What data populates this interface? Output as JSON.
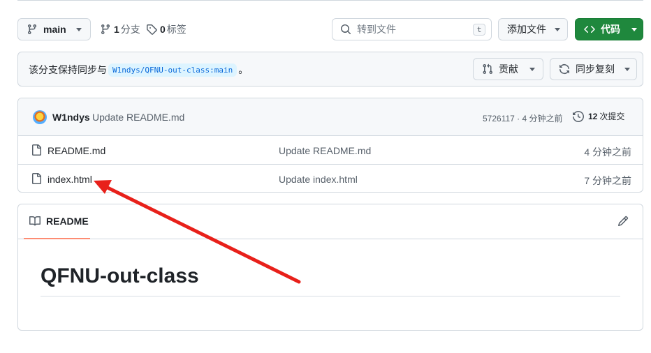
{
  "toolbar": {
    "branch_label": "main",
    "branches_count": "1",
    "branches_label": "分支",
    "tags_count": "0",
    "tags_label": "标签",
    "search_placeholder": "转到文件",
    "search_shortcut": "t",
    "add_file_label": "添加文件",
    "code_label": "代码"
  },
  "sync": {
    "text": "该分支保持同步与",
    "branch_ref": "W1ndys/QFNU-out-class:main",
    "trailing": "。",
    "contribute_label": "贡献",
    "sync_fork_label": "同步复刻"
  },
  "commit": {
    "author": "W1ndys",
    "message": "Update README.md",
    "meta": "5726117 · 4 分钟之前",
    "count": "12",
    "count_label": "次提交"
  },
  "files": [
    {
      "name": "README.md",
      "commit": "Update README.md",
      "age": "4 分钟之前"
    },
    {
      "name": "index.html",
      "commit": "Update index.html",
      "age": "7 分钟之前"
    }
  ],
  "readme": {
    "tab_label": "README",
    "title": "QFNU-out-class"
  },
  "colors": {
    "primary_button": "#1f883d",
    "annotation_arrow": "#e8201a",
    "tab_underline": "#fd8c73",
    "chip_bg": "#ddf4ff",
    "chip_text": "#0969da"
  },
  "icons": {
    "branch": "git-branch-icon",
    "tag": "tag-icon",
    "search": "search-icon",
    "code": "code-icon",
    "pull_request": "git-pull-request-icon",
    "sync": "sync-icon",
    "history": "history-icon",
    "file": "file-icon",
    "book": "book-icon",
    "pencil": "pencil-icon"
  }
}
